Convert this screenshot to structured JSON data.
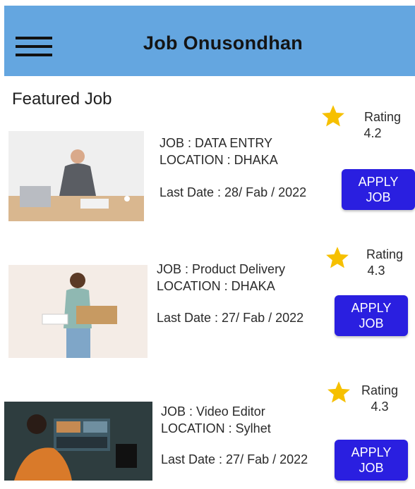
{
  "app": {
    "title": "Job Onusondhan",
    "header_color": "#64a6e0"
  },
  "section": {
    "title": "Featured Job"
  },
  "jobs": [
    {
      "job": "JOB : DATA ENTRY",
      "location": "LOCATION : DHAKA",
      "last_date": "Last Date : 28/ Fab / 2022",
      "rating_label": "Rating",
      "rating_value": "4.2",
      "apply_line1": "APPLY",
      "apply_line2": "JOB"
    },
    {
      "job": "JOB : Product Delivery",
      "location": "LOCATION : DHAKA",
      "last_date": "Last Date : 27/ Fab / 2022",
      "rating_label": "Rating",
      "rating_value": "4.3",
      "apply_line1": "APPLY",
      "apply_line2": "JOB"
    },
    {
      "job": "JOB : Video Editor",
      "location": "LOCATION : Sylhet",
      "last_date": "Last Date : 27/ Fab / 2022",
      "rating_label": "Rating",
      "rating_value": "4.3",
      "apply_line1": "APPLY",
      "apply_line2": "JOB"
    }
  ],
  "icons": {
    "menu": "menu-icon",
    "star": "star-icon"
  },
  "colors": {
    "apply_button": "#2a1fe0",
    "star": "#f6c000"
  }
}
